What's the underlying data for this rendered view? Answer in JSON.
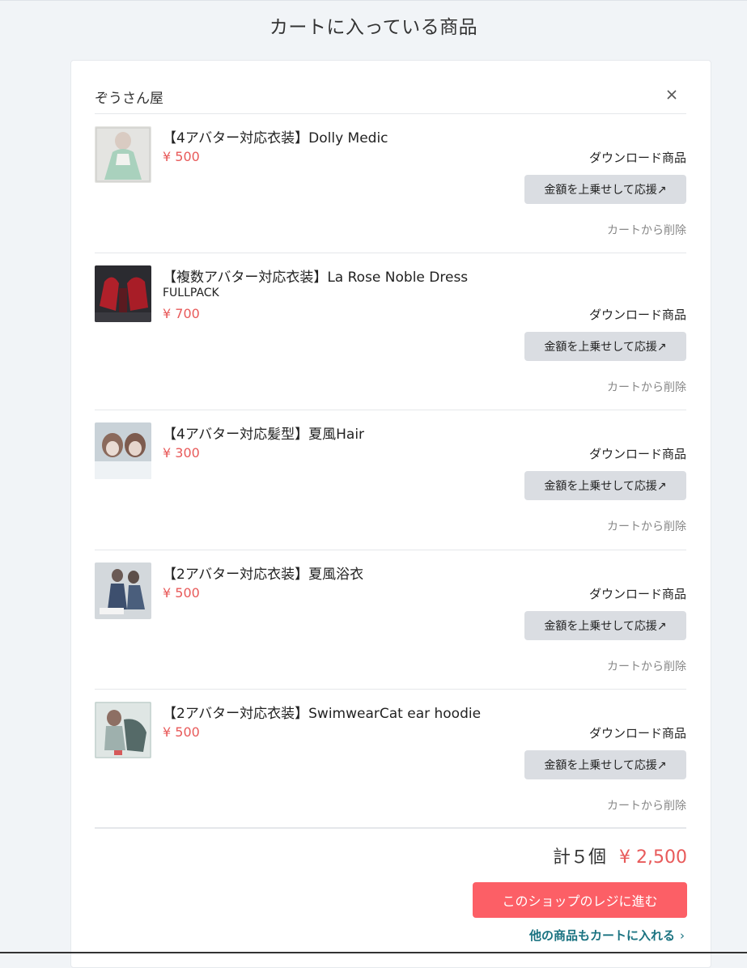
{
  "page": {
    "title": "カートに入っている商品"
  },
  "shop": {
    "name": "ぞうさん屋",
    "close_icon": "close-icon"
  },
  "items": [
    {
      "title": "【4アバター対応衣装】Dolly Medic",
      "variant": "",
      "price": "¥ 500",
      "type": "ダウンロード商品",
      "boost_label": "金額を上乗せして応援↗",
      "remove_label": "カートから削除"
    },
    {
      "title": "【複数アバター対応衣装】La Rose Noble Dress",
      "variant": "FULLPACK",
      "price": "¥ 700",
      "type": "ダウンロード商品",
      "boost_label": "金額を上乗せして応援↗",
      "remove_label": "カートから削除"
    },
    {
      "title": "【4アバター対応髪型】夏風Hair",
      "variant": "",
      "price": "¥ 300",
      "type": "ダウンロード商品",
      "boost_label": "金額を上乗せして応援↗",
      "remove_label": "カートから削除"
    },
    {
      "title": "【2アバター対応衣装】夏風浴衣",
      "variant": "",
      "price": "¥ 500",
      "type": "ダウンロード商品",
      "boost_label": "金額を上乗せして応援↗",
      "remove_label": "カートから削除"
    },
    {
      "title": "【2アバター対応衣装】SwimwearCat ear hoodie",
      "variant": "",
      "price": "¥ 500",
      "type": "ダウンロード商品",
      "boost_label": "金額を上乗せして応援↗",
      "remove_label": "カートから削除"
    }
  ],
  "summary": {
    "count_label": "計５個",
    "total_price": "¥ 2,500",
    "checkout_label": "このショップのレジに進む",
    "continue_label": "他の商品もカートに入れる",
    "continue_icon": "chevron-right-icon"
  },
  "colors": {
    "accent": "#fc5f66",
    "price": "#e85a5a",
    "link": "#1a7381"
  }
}
